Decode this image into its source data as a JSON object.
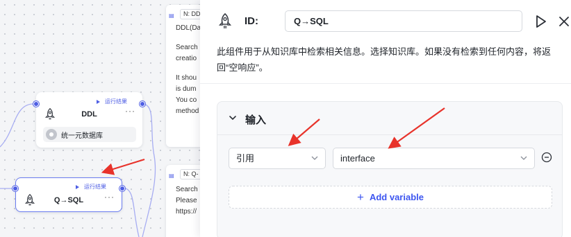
{
  "canvas": {
    "nodes": [
      {
        "title": "DDL",
        "run_label": "运行结果",
        "more": "···",
        "knowledge": "统一元数据库"
      },
      {
        "title": "Q→SQL",
        "run_label": "运行结果",
        "more": "···"
      }
    ],
    "notes": [
      {
        "tag": "N: DD",
        "lines": [
          "DDL(Da",
          "",
          "Search",
          "creatio",
          "",
          "It shou",
          "is dum",
          "You co",
          "method"
        ]
      },
      {
        "tag": "N: Q-",
        "lines": [
          "Search",
          "Please",
          "https://"
        ]
      }
    ]
  },
  "panel": {
    "id_label": "ID:",
    "id_value": "Q→SQL",
    "description": "此组件用于从知识库中检索相关信息。选择知识库。如果没有检索到任何内容，将返回“空响应”。",
    "input_section": {
      "title": "输入",
      "ref_select": "引用",
      "variable_select": "interface",
      "add_variable_label": "Add variable"
    },
    "icons": {
      "component": "rocket-icon",
      "run": "play-icon",
      "close": "close-icon",
      "collapse": "chevron-down-icon",
      "remove": "minus-circle-icon",
      "add": "plus-icon"
    },
    "colors": {
      "accent": "#3d56f0",
      "annotation_arrow": "#e8332b"
    }
  }
}
